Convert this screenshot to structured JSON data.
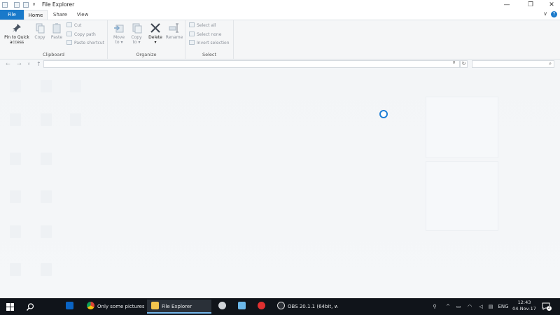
{
  "window": {
    "title": "File Explorer",
    "qat_dropdown": "∨",
    "controls": {
      "minimize": "—",
      "maximize": "❐",
      "close": "✕"
    }
  },
  "tabs": {
    "file": "File",
    "home": "Home",
    "share": "Share",
    "view": "View",
    "help": "?",
    "collapse": "∨"
  },
  "ribbon": {
    "clipboard": {
      "label": "Clipboard",
      "pin_line1": "Pin to Quick",
      "pin_line2": "access",
      "copy": "Copy",
      "paste": "Paste",
      "cut": "Cut",
      "copy_path": "Copy path",
      "paste_shortcut": "Paste shortcut"
    },
    "organize": {
      "label": "Organize",
      "move_line1": "Move",
      "move_line2": "to ▾",
      "copy_line1": "Copy",
      "copy_line2": "to ▾",
      "delete": "Delete",
      "delete_drop": "▾",
      "rename": "Rename"
    },
    "select": {
      "label": "Select",
      "select_all": "Select all",
      "select_none": "Select none",
      "invert": "Invert selection"
    }
  },
  "nav": {
    "back": "←",
    "forward": "→",
    "recent": "∨",
    "up": "↑",
    "address_drop": "∨",
    "refresh": "↻",
    "search_icon": "⌕"
  },
  "taskbar": {
    "apps": [
      {
        "label": "",
        "icon": "outlook-icon",
        "color": "#0a64c4"
      },
      {
        "label": "Only some pictures...",
        "icon": "chrome-icon",
        "color": "#e0b32d"
      },
      {
        "label": "File Explorer",
        "icon": "folder-icon",
        "color": "#f2c44d"
      },
      {
        "label": "OBS 20.1.1 (64bit, w...",
        "icon": "obs-icon",
        "color": "#e5e5e5"
      }
    ],
    "language": "ENG",
    "time": "12:43",
    "date": "04-Nov-17",
    "notification_count": "2"
  }
}
